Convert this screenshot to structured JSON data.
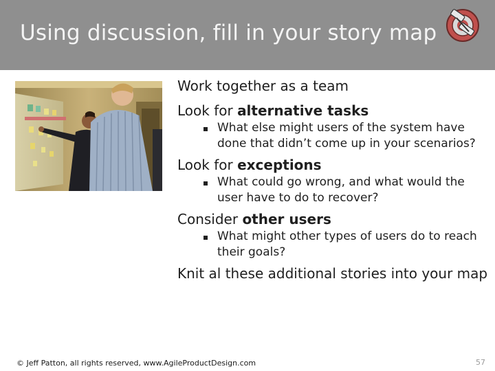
{
  "slide": {
    "title": "Using discussion, fill in your story map",
    "logo_icon": "target-with-hands-logo-icon",
    "photo_icon": "team-at-whiteboard-photo",
    "items": [
      {
        "text": "Work together as a team"
      },
      {
        "prefix": "Look for ",
        "emphasis": "alternative tasks",
        "sub": "What else might users of the system have done that didn’t come up in your scenarios?"
      },
      {
        "prefix": "Look for ",
        "emphasis": "exceptions",
        "sub": "What could go wrong, and what would the user have to do to recover?"
      },
      {
        "prefix": "Consider ",
        "emphasis": "other users",
        "sub": "What might other types of users do to reach their goals?"
      },
      {
        "text": "Knit al these additional stories into your map"
      }
    ],
    "footer": "© Jeff Patton, all rights reserved, www.AgileProductDesign.com",
    "page_number": "57"
  },
  "colors": {
    "header_bg": "#8f8f8f",
    "title_text": "#f4f4f4",
    "logo_red": "#c0504d"
  }
}
